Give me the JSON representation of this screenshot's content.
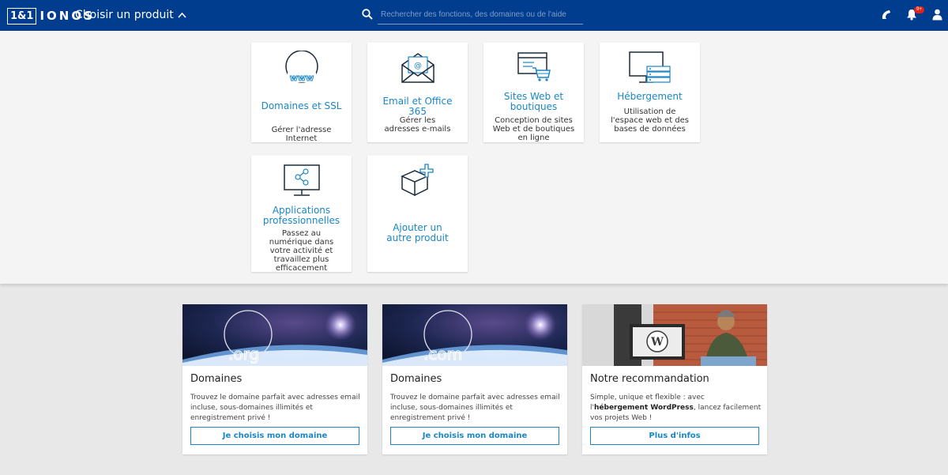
{
  "header": {
    "logo_box": "1&1",
    "logo_text": "IONOS",
    "product_chooser": "Choisir un produit",
    "search_placeholder": "Rechercher des fonctions, des domaines ou de l'aide",
    "notification_count": "9+",
    "icons": [
      "search-icon",
      "phone-icon",
      "bell-icon",
      "user-icon"
    ]
  },
  "products": [
    {
      "title": "Domaines et SSL",
      "desc": "Gérer l'adresse Internet",
      "icon": "www-globe-icon"
    },
    {
      "title": "Email et Office 365",
      "desc": "Gérer les adresses e-mails",
      "icon": "envelope-icon"
    },
    {
      "title": "Sites Web et boutiques",
      "desc": "Conception de sites Web et de boutiques en ligne",
      "icon": "web-shop-icon"
    },
    {
      "title": "Hébergement",
      "desc": "Utilisation de l'espace web et des bases de données",
      "icon": "hosting-server-icon"
    },
    {
      "title": "Applications professionnelles",
      "desc": "Passez au numérique dans votre activité et travaillez plus efficacement",
      "icon": "share-monitor-icon"
    },
    {
      "title": "Ajouter un autre produit",
      "desc": "",
      "icon": "add-box-icon"
    }
  ],
  "promos": [
    {
      "image_label": ".org",
      "title": "Domaines",
      "text": "Trouvez le domaine parfait avec adresses email incluse, sous-domaines illimités et enregistrement privé !",
      "button": "Je choisis mon domaine"
    },
    {
      "image_label": ".com",
      "title": "Domaines",
      "text": "Trouvez le domaine parfait avec adresses email incluse, sous-domaines illimités et enregistrement privé !",
      "button": "Je choisis mon domaine"
    },
    {
      "title": "Notre recommandation",
      "text_pre": "Simple, unique et flexible : avec l'",
      "text_bold1": "hébergement WordPress",
      "text_post": ", lancez facilement vos projets Web !",
      "button": "Plus d'infos"
    }
  ],
  "colors": {
    "header_bg": "#003d8f",
    "accent": "#1a86c6",
    "badge": "#e2231a"
  }
}
